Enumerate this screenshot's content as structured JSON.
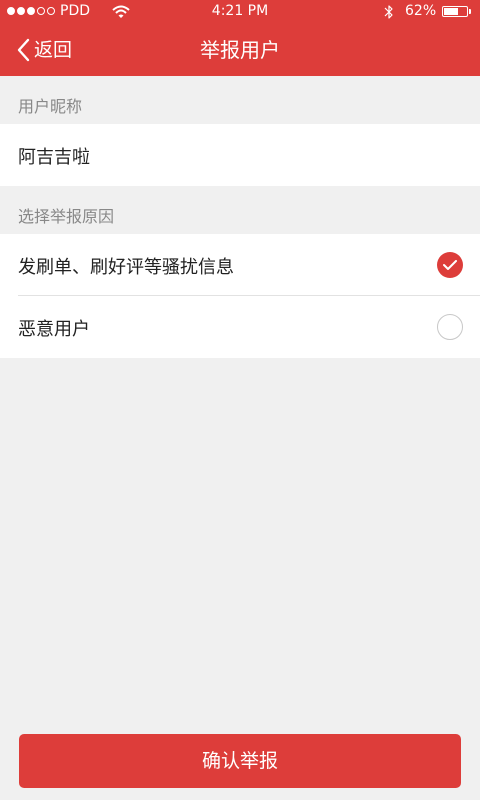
{
  "status_bar": {
    "carrier": "PDD",
    "time": "4:21 PM",
    "battery_percent": "62%",
    "battery_level": 0.62,
    "signal_strength": 3,
    "signal_max": 5
  },
  "nav": {
    "back_label": "返回",
    "title": "举报用户"
  },
  "nickname_section": {
    "header": "用户昵称",
    "value": "阿吉吉啦"
  },
  "reason_section": {
    "header": "选择举报原因",
    "options": [
      {
        "label": "发刷单、刷好评等骚扰信息",
        "selected": true
      },
      {
        "label": "恶意用户",
        "selected": false
      }
    ]
  },
  "confirm_label": "确认举报",
  "colors": {
    "accent": "#dd3d3a",
    "background": "#f0f0f0"
  }
}
